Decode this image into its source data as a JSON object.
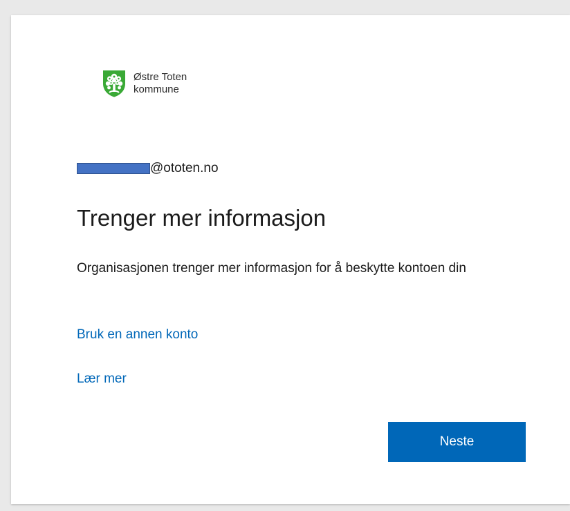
{
  "org": {
    "name_line1": "Østre Toten",
    "name_line2": "kommune",
    "logo_icon": "coat-of-arms-tree-icon",
    "logo_color": "#3aa936"
  },
  "identity": {
    "email_suffix": "@ototen.no",
    "redaction_color": "#4472c4"
  },
  "page": {
    "title": "Trenger mer informasjon",
    "description": "Organisasjonen trenger mer informasjon for å beskytte kontoen din"
  },
  "links": {
    "use_other_account": "Bruk en annen konto",
    "learn_more": "Lær mer"
  },
  "actions": {
    "next_label": "Neste",
    "accent_color": "#0067b8"
  }
}
